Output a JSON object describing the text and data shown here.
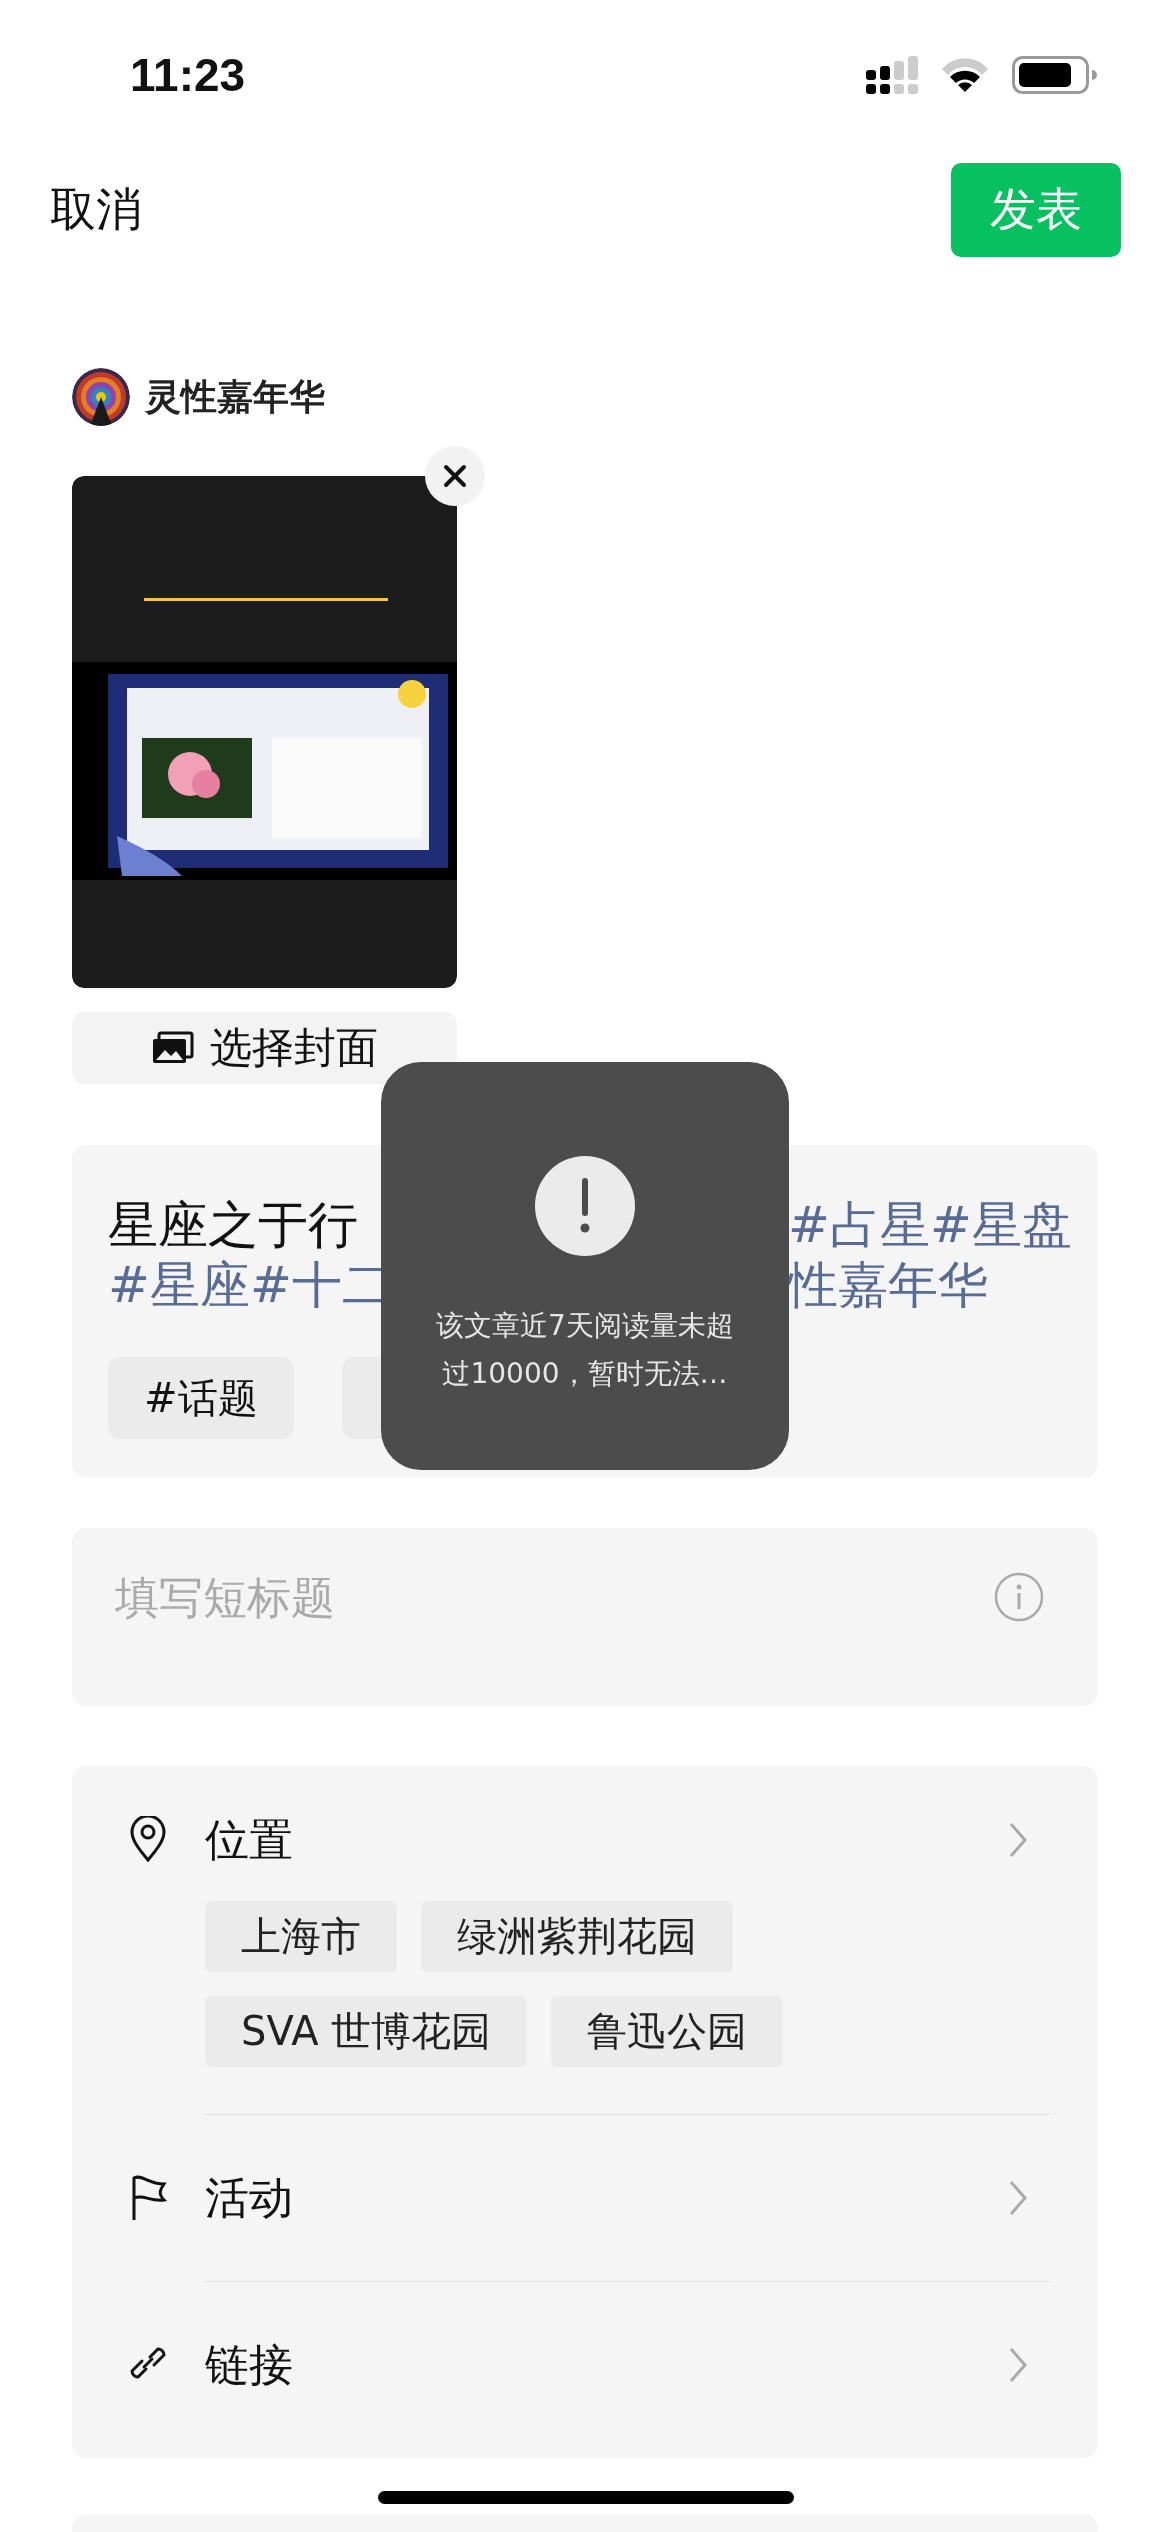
{
  "status_bar": {
    "time": "11:23"
  },
  "nav": {
    "cancel": "取消",
    "publish": "发表"
  },
  "author": {
    "name": "灵性嘉年华"
  },
  "cover": {
    "kind": "picture",
    "choose_label": "选择封面"
  },
  "post": {
    "lines": [
      [
        {
          "text": "星座之于行",
          "kind": "text"
        },
        {
          "text": "#占星#星盘",
          "kind": "hashtag"
        }
      ],
      [
        {
          "text": "#星座#十二",
          "kind": "hashtag"
        },
        {
          "text": "性嘉年华",
          "kind": "hashtag"
        }
      ]
    ],
    "topics": [
      "#话题"
    ]
  },
  "short_title": {
    "placeholder": "填写短标题"
  },
  "options": [
    {
      "kind": "location",
      "label": "位置",
      "tags": [
        "上海市",
        "绿洲紫荆花园",
        "SVA 世博花园",
        "鲁迅公园"
      ]
    },
    {
      "kind": "activity",
      "label": "活动"
    },
    {
      "kind": "link",
      "label": "链接"
    }
  ],
  "toast": {
    "message": "该文章近7天阅读量未超过10000，暂时无法…"
  }
}
